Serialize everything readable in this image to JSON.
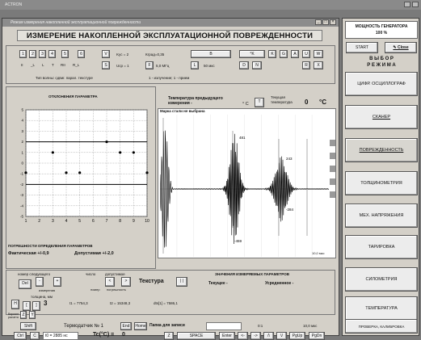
{
  "outer_window": {
    "title": "ACTRON"
  },
  "window": {
    "title": "Режим измерения накопленной эксплуатационной поврежденности"
  },
  "heading": "ИЗМЕРЕНИЕ НАКОПЛЕННОЙ ЭКСПЛУАТАЦИОННОЙ ПОВРЕЖДЕННОСТИ",
  "toolbar": {
    "number_buttons": [
      "1",
      "2",
      "3",
      "4",
      "5",
      "6"
    ],
    "mode_buttons": [
      "II",
      "_L",
      "L",
      "T",
      "RII",
      "R_L"
    ],
    "v_label": "V",
    "kus": "Kус = 2",
    "kgrad": "Кград=0,35",
    "b_button": "B",
    "temp_unit_button": "°K",
    "k_button": "K",
    "g_button": "G",
    "a_button": "A",
    "u_button": "U",
    "w_button": "W",
    "s_button": "S",
    "ucp": "Uср = 1",
    "f_button": "F",
    "freq": "5,0 МГц",
    "l_button": "L",
    "len": "50 мкс",
    "d_button": "D",
    "n_button": "N",
    "r_button": "R",
    "x_button": "X",
    "wave_type": "Тип волны: сдвиг. парал. текстуре",
    "measure_mode": "1 - излучение; 1 - прием"
  },
  "temperature": {
    "prev_label": "Температура предыдущего измерения -",
    "unit": "° C",
    "t_button": "T",
    "current_label": "Текущая температура",
    "current_value": "0",
    "current_unit": "°C"
  },
  "left_chart": {
    "title": "ОТКЛОНЕНИЯ ПАРАМЕТРА",
    "y_ticks": [
      "5",
      "4",
      "3",
      "2",
      "1",
      "0",
      "-1",
      "-2",
      "-3",
      "-4",
      "-5"
    ],
    "x_ticks": [
      "1",
      "2",
      "3",
      "4",
      "5",
      "6",
      "7",
      "8",
      "9",
      "10"
    ]
  },
  "scope": {
    "title": "Марка стали не выбрана",
    "labels": [
      "481",
      "243",
      "-284",
      "-459"
    ],
    "corner_unit": "10,0 мкс"
  },
  "chart_data": [
    {
      "type": "scatter",
      "title": "ОТКЛОНЕНИЯ ПАРАМЕТРА",
      "xlim": [
        1,
        10
      ],
      "ylim": [
        -5,
        5
      ],
      "x_ticks": [
        "1",
        "2",
        "3",
        "4",
        "5",
        "6",
        "7",
        "8",
        "9",
        "10"
      ],
      "y_ticks": [
        "5",
        "4",
        "3",
        "2",
        "1",
        "0",
        "-1",
        "-2",
        "-3",
        "-4",
        "-5"
      ],
      "grid": true,
      "reference_lines": [
        2.0,
        -2.0
      ],
      "points": [
        {
          "x": 0,
          "y": -0.9
        },
        {
          "x": 3,
          "y": 1.0
        },
        {
          "x": 4,
          "y": -0.9
        },
        {
          "x": 5,
          "y": -0.9
        },
        {
          "x": 7,
          "y": 2.0
        },
        {
          "x": 8,
          "y": 1.0
        },
        {
          "x": 9,
          "y": 1.0
        },
        {
          "x": 10,
          "y": -0.9
        }
      ]
    }
  ],
  "errors": {
    "title": "ПОГРЕШНОСТИ ОПРЕДЕЛЕНИЯ ПАРАМЕТРОВ",
    "actual": "Фактическая +/-0,9",
    "allowed": "Допустимая +/-2,0"
  },
  "controls": {
    "next_label": "номер следующего",
    "count_label": "число",
    "allowed_label": "допустимое",
    "del_button": "Del",
    "minus_button": "-",
    "plus_button": "+",
    "measure_label": "измерения",
    "nomer_label": "номер",
    "pogr_label": "погрешность",
    "lt_button": "<",
    "gt_button": ">",
    "texture_label": "Текстура",
    "pause_button": "| |",
    "values_title": "ЗНАЧЕНИЯ ИЗМЕРЯЕМЫХ ПАРАМЕТРОВ",
    "current_label": "Текущее -",
    "averaged_label": "Усредненное -"
  },
  "thickness": {
    "label": "толщина, мм",
    "h_button": "H",
    "bracket_l": "[",
    "bracket_r": "]",
    "value": "3",
    "variant_label": "Вариант расчета",
    "z_button": "Z",
    "y_button": "Y",
    "t1": "t1 = 7754,3",
    "t2": "t2 = 15348,3",
    "dts": "dts[1] = 7586,1"
  },
  "bottom": {
    "shift": "Shift",
    "ctrl": "Ctrl",
    "c_button": "C",
    "t0": "t0 = 2885 нс",
    "thermo": "Термодатчик № 1",
    "end": "End",
    "home": "Home",
    "folder": "Папка для записи",
    "ratio": "0:1",
    "period": "10,0 мкс",
    "tc": "Tc(°C) =",
    "tc_value": "0",
    "keys": [
      "Z",
      "SPACE",
      "Enter",
      "<-",
      "->",
      "/\\",
      "\\/",
      "PgUp",
      "PgDn"
    ]
  },
  "sidebar": {
    "power_title": "МОЩНОСТЬ ГЕНЕРАТОРА",
    "power_value": "100 %",
    "start": "START",
    "close": "Close",
    "mode_title": "В Ы Б О Р",
    "mode_sub": "Р Е Ж И М А",
    "items": [
      "ЦИФР. ОСЦИЛЛОГРАФ",
      "СКАНЕР",
      "ПОВРЕЖДЕННОСТЬ",
      "ТОЛЩИНОМЕТРИЯ",
      "МЕХ. НАПРЯЖЕНИЯ",
      "ТАРИРОВКА",
      "СИЛОМЕТРИЯ",
      "ТЕМПЕРАТУРА",
      "ПРОВЕРКА, КАЛИБРОВКА"
    ]
  },
  "colors": {
    "background": "#7a7a7a",
    "panel": "#d4d0c8",
    "title_bar": "#8c8c8c",
    "plot_bg": "#ffffff"
  }
}
